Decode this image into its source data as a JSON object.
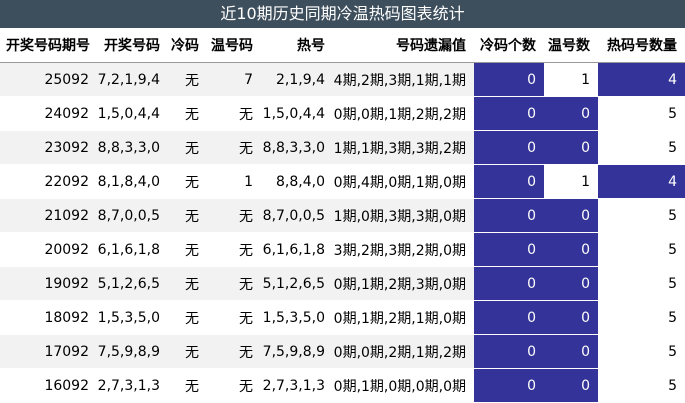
{
  "title": "近10期历史同期冷温热码图表统计",
  "headers": [
    "开奖号码期号",
    "开奖号码",
    "冷码",
    "温号码",
    "热号",
    "号码遗漏值",
    "冷码个数",
    "温号数",
    "热码号数量"
  ],
  "rows": [
    {
      "issue": "25092",
      "draw": "7,2,1,9,4",
      "cold": "无",
      "warm": "7",
      "hot": "2,1,9,4",
      "omission": "4期,2期,3期,1期,1期",
      "cold_count": "0",
      "warm_count": "1",
      "hot_count": "4"
    },
    {
      "issue": "24092",
      "draw": "1,5,0,4,4",
      "cold": "无",
      "warm": "无",
      "hot": "1,5,0,4,4",
      "omission": "0期,0期,1期,2期,2期",
      "cold_count": "0",
      "warm_count": "0",
      "hot_count": "5"
    },
    {
      "issue": "23092",
      "draw": "8,8,3,3,0",
      "cold": "无",
      "warm": "无",
      "hot": "8,8,3,3,0",
      "omission": "1期,1期,3期,3期,2期",
      "cold_count": "0",
      "warm_count": "0",
      "hot_count": "5"
    },
    {
      "issue": "22092",
      "draw": "8,1,8,4,0",
      "cold": "无",
      "warm": "1",
      "hot": "8,8,4,0",
      "omission": "0期,4期,0期,1期,0期",
      "cold_count": "0",
      "warm_count": "1",
      "hot_count": "4"
    },
    {
      "issue": "21092",
      "draw": "8,7,0,0,5",
      "cold": "无",
      "warm": "无",
      "hot": "8,7,0,0,5",
      "omission": "1期,0期,3期,3期,0期",
      "cold_count": "0",
      "warm_count": "0",
      "hot_count": "5"
    },
    {
      "issue": "20092",
      "draw": "6,1,6,1,8",
      "cold": "无",
      "warm": "无",
      "hot": "6,1,6,1,8",
      "omission": "3期,2期,3期,2期,0期",
      "cold_count": "0",
      "warm_count": "0",
      "hot_count": "5"
    },
    {
      "issue": "19092",
      "draw": "5,1,2,6,5",
      "cold": "无",
      "warm": "无",
      "hot": "5,1,2,6,5",
      "omission": "0期,1期,2期,3期,0期",
      "cold_count": "0",
      "warm_count": "0",
      "hot_count": "5"
    },
    {
      "issue": "18092",
      "draw": "1,5,3,5,0",
      "cold": "无",
      "warm": "无",
      "hot": "1,5,3,5,0",
      "omission": "0期,1期,2期,1期,0期",
      "cold_count": "0",
      "warm_count": "0",
      "hot_count": "5"
    },
    {
      "issue": "17092",
      "draw": "7,5,9,8,9",
      "cold": "无",
      "warm": "无",
      "hot": "7,5,9,8,9",
      "omission": "0期,0期,2期,1期,2期",
      "cold_count": "0",
      "warm_count": "0",
      "hot_count": "5"
    },
    {
      "issue": "16092",
      "draw": "2,7,3,1,3",
      "cold": "无",
      "warm": "无",
      "hot": "2,7,3,1,3",
      "omission": "0期,1期,0期,0期,0期",
      "cold_count": "0",
      "warm_count": "0",
      "hot_count": "5"
    }
  ],
  "colors": {
    "title_bg": "#3d4e5c",
    "highlight": "#333399",
    "stripe": "#f2f2f2"
  }
}
